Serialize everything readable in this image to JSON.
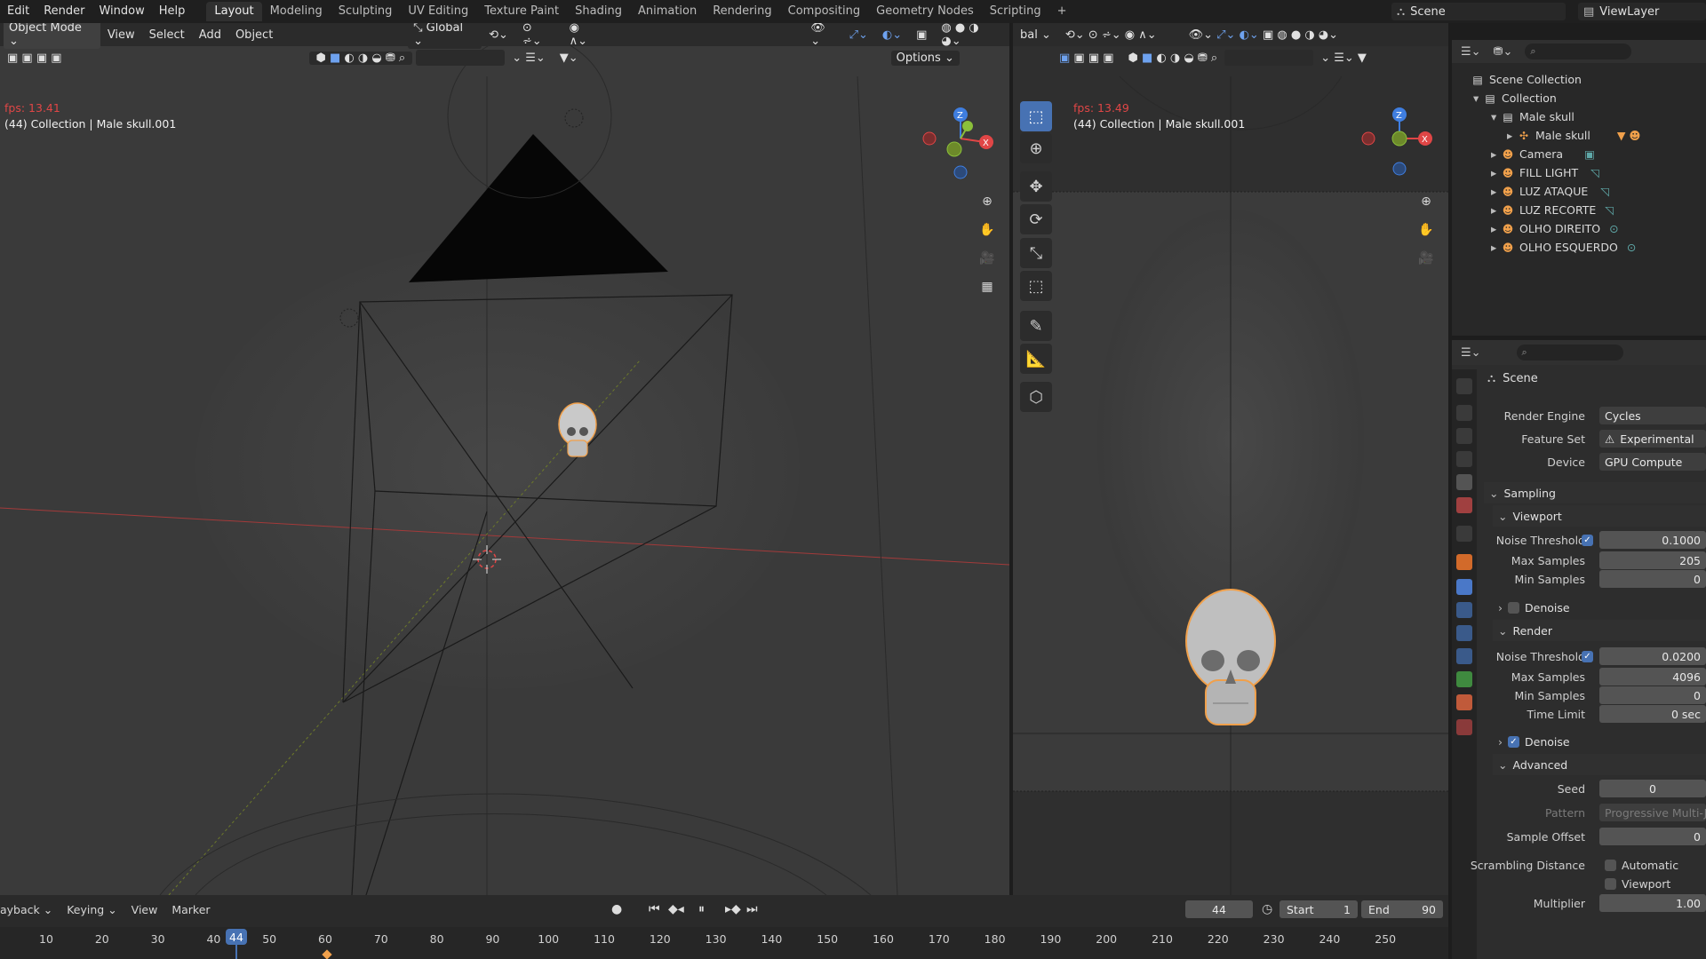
{
  "menu": {
    "items": [
      "Edit",
      "Render",
      "Window",
      "Help"
    ]
  },
  "workspaces": [
    "Layout",
    "Modeling",
    "Sculpting",
    "UV Editing",
    "Texture Paint",
    "Shading",
    "Animation",
    "Rendering",
    "Compositing",
    "Geometry Nodes",
    "Scripting",
    "+"
  ],
  "active_workspace": "Layout",
  "scene_name": "Scene",
  "view_layer": "ViewLayer",
  "left_viewport": {
    "mode": "Object Mode",
    "header_items": [
      "View",
      "Select",
      "Add",
      "Object"
    ],
    "transform_orientation": "Global",
    "options_label": "Options",
    "fps": "fps: 13.41",
    "info": "(44) Collection | Male skull.001"
  },
  "right_viewport": {
    "transform_partial": "bal",
    "fps": "fps: 13.49",
    "info": "(44) Collection | Male skull.001"
  },
  "outliner": {
    "root": "Scene Collection",
    "rows": [
      {
        "label": "Collection",
        "icon": "collection-icon",
        "depth": 1
      },
      {
        "label": "Male skull",
        "icon": "collection-icon",
        "depth": 2
      },
      {
        "label": "Male skull",
        "icon": "armature-icon",
        "depth": 3
      },
      {
        "label": "Camera",
        "icon": "camera-icon",
        "depth": 2
      },
      {
        "label": "FILL LIGHT",
        "icon": "light-icon",
        "depth": 2
      },
      {
        "label": "LUZ ATAQUE",
        "icon": "light-icon",
        "depth": 2
      },
      {
        "label": "LUZ RECORTE",
        "icon": "light-icon",
        "depth": 2
      },
      {
        "label": "OLHO DIREITO",
        "icon": "light-icon",
        "depth": 2
      },
      {
        "label": "OLHO ESQUERDO",
        "icon": "light-icon",
        "depth": 2
      }
    ]
  },
  "properties": {
    "context": "Scene",
    "render_engine_label": "Render Engine",
    "render_engine": "Cycles",
    "feature_set_label": "Feature Set",
    "feature_set": "Experimental",
    "device_label": "Device",
    "device": "GPU Compute",
    "sampling": "Sampling",
    "viewport": "Viewport",
    "noise_threshold_label": "Noise Threshold",
    "vp_noise_threshold": "0.1000",
    "max_samples_label": "Max Samples",
    "vp_max_samples": "205",
    "min_samples_label": "Min Samples",
    "vp_min_samples": "0",
    "denoise": "Denoise",
    "render": "Render",
    "r_noise_threshold": "0.0200",
    "r_max_samples": "4096",
    "r_min_samples": "0",
    "time_limit_label": "Time Limit",
    "r_time_limit": "0 sec",
    "advanced": "Advanced",
    "seed_label": "Seed",
    "seed": "0",
    "pattern_label": "Pattern",
    "pattern": "Progressive Multi-Jitt",
    "sample_offset_label": "Sample Offset",
    "sample_offset": "0",
    "scrambling_label": "Scrambling Distance",
    "automatic": "Automatic",
    "scr_viewport": "Viewport",
    "multiplier_label": "Multiplier",
    "multiplier": "1.00"
  },
  "timeline": {
    "menu": [
      "ayback",
      "Keying",
      "View",
      "Marker"
    ],
    "current_frame": "44",
    "start_label": "Start",
    "start": "1",
    "end_label": "End",
    "end": "90",
    "ruler": [
      "10",
      "20",
      "30",
      "40",
      "44",
      "50",
      "60",
      "70",
      "80",
      "90",
      "100",
      "110",
      "120",
      "130",
      "140",
      "150",
      "160",
      "170",
      "180",
      "190",
      "200",
      "210",
      "220",
      "230",
      "240",
      "250"
    ]
  },
  "colors": {
    "accent": "#4772b3",
    "fps": "#e04646",
    "selection_outline": "#f0a04b",
    "axis_x": "#e04646",
    "axis_y": "#8bbf3a",
    "axis_z": "#3f7ee0"
  }
}
